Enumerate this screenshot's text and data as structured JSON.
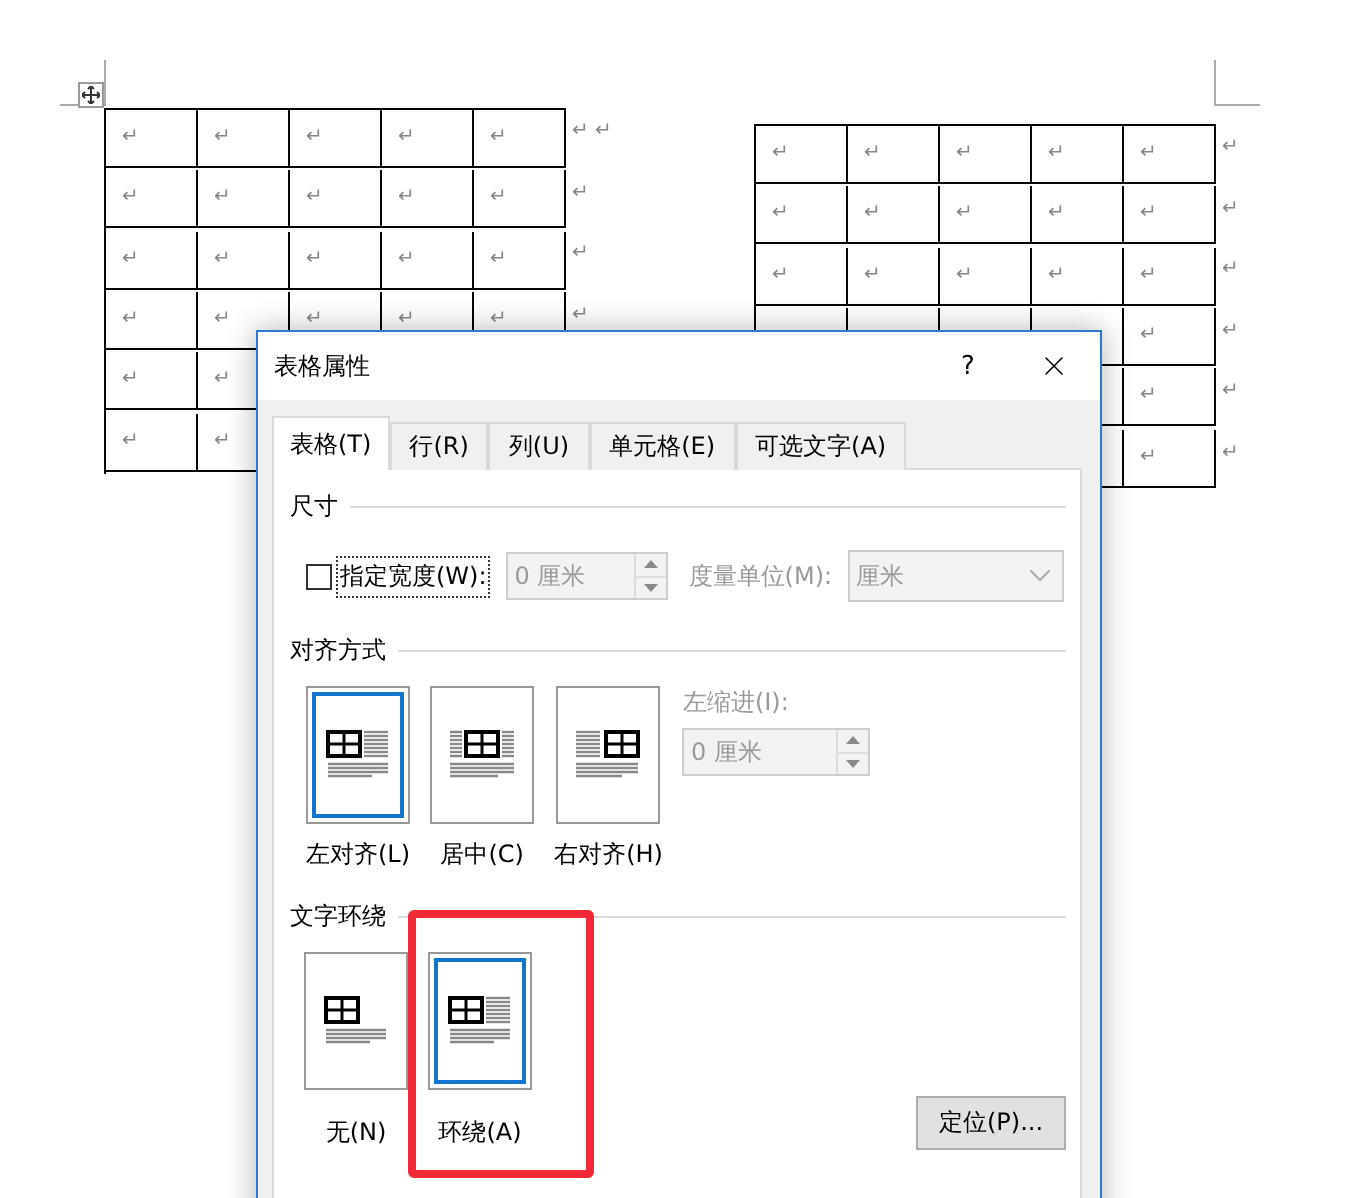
{
  "document": {
    "tables": [
      {
        "rows": [
          {
            "cells": [
              "↵",
              "↵",
              "↵",
              "↵",
              "↵"
            ],
            "end": "↵ ↵"
          },
          {
            "cells": [
              "↵",
              "↵",
              "↵",
              "↵",
              "↵"
            ],
            "end": "↵"
          },
          {
            "cells": [
              "↵",
              "↵",
              "↵",
              "↵",
              "↵"
            ],
            "end": "↵"
          },
          {
            "cells": [
              "↵",
              "↵",
              "↵",
              "↵",
              "↵"
            ],
            "end": "↵"
          },
          {
            "cells": [
              "↵",
              "↵",
              null,
              null,
              null
            ],
            "end": null
          },
          {
            "cells": [
              "↵",
              "↵",
              null,
              null,
              null
            ],
            "end": null
          }
        ]
      },
      {
        "rows": [
          {
            "cells": [
              "↵",
              "↵",
              "↵",
              "↵",
              "↵"
            ],
            "end": "↵"
          },
          {
            "cells": [
              "↵",
              "↵",
              "↵",
              "↵",
              "↵"
            ],
            "end": "↵"
          },
          {
            "cells": [
              "↵",
              "↵",
              "↵",
              "↵",
              "↵"
            ],
            "end": "↵"
          },
          {
            "cells": [
              null,
              null,
              null,
              null,
              "↵"
            ],
            "end": "↵"
          },
          {
            "cells": [
              null,
              null,
              null,
              null,
              "↵"
            ],
            "end": "↵"
          },
          {
            "cells": [
              null,
              null,
              null,
              null,
              "↵"
            ],
            "end": "↵"
          }
        ]
      }
    ]
  },
  "dialog": {
    "title": "表格属性",
    "help": "?",
    "tabs": [
      {
        "label": "表格(T)",
        "selected": true
      },
      {
        "label": "行(R)",
        "selected": false
      },
      {
        "label": "列(U)",
        "selected": false
      },
      {
        "label": "单元格(E)",
        "selected": false
      },
      {
        "label": "可选文字(A)",
        "selected": false
      }
    ],
    "size": {
      "heading": "尺寸",
      "width_checkbox": {
        "label": "指定宽度(W):",
        "checked": false
      },
      "width_field": {
        "value": "0 厘米",
        "disabled": true
      },
      "unit_label": "度量单位(M):",
      "unit_select": {
        "value": "厘米",
        "disabled": true
      }
    },
    "alignment": {
      "heading": "对齐方式",
      "options": [
        {
          "kind": "left",
          "label": "左对齐(L)",
          "selected": true
        },
        {
          "kind": "center",
          "label": "居中(C)",
          "selected": false
        },
        {
          "kind": "right",
          "label": "右对齐(H)",
          "selected": false
        }
      ],
      "indent_label": "左缩进(I):",
      "indent_field": {
        "value": "0 厘米",
        "disabled": true
      }
    },
    "wrapping": {
      "heading": "文字环绕",
      "options": [
        {
          "kind": "none",
          "label": "无(N)",
          "selected": false,
          "highlighted": false
        },
        {
          "kind": "around",
          "label": "环绕(A)",
          "selected": true,
          "highlighted": true
        }
      ]
    },
    "position_button": "定位(P)..."
  }
}
